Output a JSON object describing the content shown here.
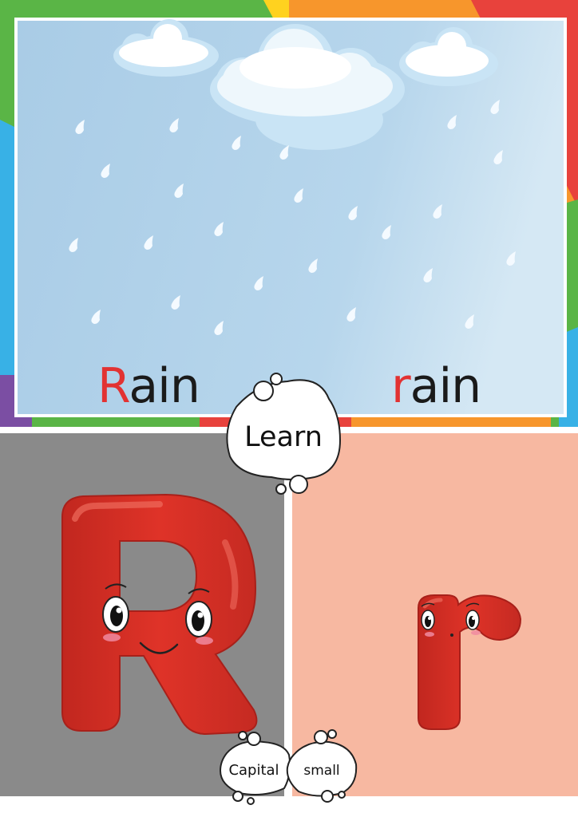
{
  "top_panel": {
    "word_capital": {
      "first_letter": "R",
      "rest": "ain"
    },
    "word_small": {
      "first_letter": "r",
      "rest": "ain"
    }
  },
  "center_bubble": {
    "label": "Learn"
  },
  "bottom_panels": {
    "capital_label": "Capital",
    "small_label": "small",
    "left_bg_color": "#8a8a8a",
    "right_bg_color": "#f7b8a1"
  },
  "colors": {
    "accent_red": "#e23232",
    "sky": "#b9d8ee",
    "frame_rainbow": [
      "#e8423c",
      "#f7962c",
      "#ffd21f",
      "#5ab546",
      "#38b1e6",
      "#7b4ea3"
    ]
  },
  "icons": [
    "rain-cloud-icon",
    "raindrop-icon",
    "letter-R-character",
    "letter-r-character"
  ]
}
